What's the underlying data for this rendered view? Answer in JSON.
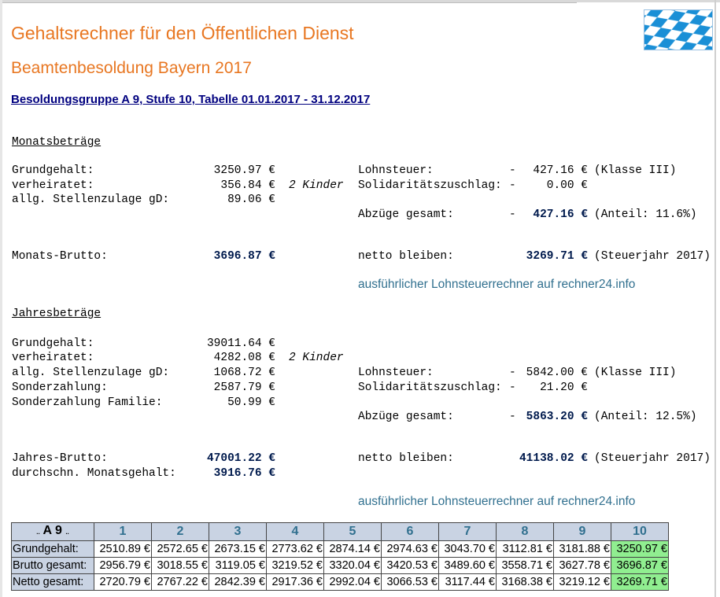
{
  "page": {
    "title": "Gehaltsrechner für den Öffentlichen Dienst",
    "subtitle": "Beamtenbesoldung Bayern 2017",
    "heading": "Besoldungsgruppe A 9, Stufe 10, Tabelle 01.01.2017 - 31.12.2017"
  },
  "flag_colors": {
    "blue": "#1a8fd6",
    "white": "#ffffff"
  },
  "monthly": {
    "section": "Monatsbeträge",
    "left": [
      {
        "label": "Grundgehalt:",
        "value": "3250.97 €",
        "note": ""
      },
      {
        "label": "verheiratet:",
        "value": "356.84 €",
        "note": "2 Kinder"
      },
      {
        "label": "allg. Stellenzulage gD:",
        "value": "89.06 €",
        "note": ""
      }
    ],
    "right": [
      {
        "label": "Lohnsteuer:",
        "sign": "-",
        "value": "427.16 €",
        "extra": "(Klasse III)"
      },
      {
        "label": "Solidaritätszuschlag:",
        "sign": "-",
        "value": "0.00 €",
        "extra": ""
      }
    ],
    "deductions": {
      "label": "Abzüge gesamt:",
      "sign": "-",
      "value": "427.16 €",
      "extra": "(Anteil: 11.6%)"
    },
    "gross": {
      "label": "Monats-Brutto:",
      "value": "3696.87 €"
    },
    "net": {
      "label": "netto bleiben:",
      "value": "3269.71 €",
      "extra": "(Steuerjahr 2017)"
    },
    "link": "ausführlicher Lohnsteuerrechner auf rechner24.info"
  },
  "yearly": {
    "section": "Jahresbeträge",
    "left": [
      {
        "label": "Grundgehalt:",
        "value": "39011.64 €",
        "note": ""
      },
      {
        "label": "verheiratet:",
        "value": "4282.08 €",
        "note": "2 Kinder"
      },
      {
        "label": "allg. Stellenzulage gD:",
        "value": "1068.72 €",
        "note": ""
      },
      {
        "label": "Sonderzahlung:",
        "value": "2587.79 €",
        "note": ""
      },
      {
        "label": "Sonderzahlung Familie:",
        "value": "50.99 €",
        "note": ""
      }
    ],
    "right": [
      {
        "label": "Lohnsteuer:",
        "sign": "-",
        "value": "5842.00 €",
        "extra": "(Klasse III)"
      },
      {
        "label": "Solidaritätszuschlag:",
        "sign": "-",
        "value": "21.20 €",
        "extra": ""
      }
    ],
    "deductions": {
      "label": "Abzüge gesamt:",
      "sign": "-",
      "value": "5863.20 €",
      "extra": "(Anteil: 12.5%)"
    },
    "gross": {
      "label": "Jahres-Brutto:",
      "value": "47001.22 €"
    },
    "avg": {
      "label": "durchschn. Monatsgehalt:",
      "value": "3916.76 €"
    },
    "net": {
      "label": "netto bleiben:",
      "value": "41138.02 €",
      "extra": "(Steuerjahr 2017)"
    },
    "link": "ausführlicher Lohnsteuerrechner auf rechner24.info"
  },
  "table": {
    "corner": {
      "pre": "..",
      "main": "A 9",
      "post": ".."
    },
    "columns": [
      "1",
      "2",
      "3",
      "4",
      "5",
      "6",
      "7",
      "8",
      "9",
      "10"
    ],
    "highlight_color": "#90ee90",
    "rows": [
      {
        "label": "Grundgehalt:",
        "values": [
          "2510.89 €",
          "2572.65 €",
          "2673.15 €",
          "2773.62 €",
          "2874.14 €",
          "2974.63 €",
          "3043.70 €",
          "3112.81 €",
          "3181.88 €",
          "3250.97 €"
        ]
      },
      {
        "label": "Brutto gesamt:",
        "values": [
          "2956.79 €",
          "3018.55 €",
          "3119.05 €",
          "3219.52 €",
          "3320.04 €",
          "3420.53 €",
          "3489.60 €",
          "3558.71 €",
          "3627.78 €",
          "3696.87 €"
        ]
      },
      {
        "label": "Netto gesamt:",
        "values": [
          "2720.79 €",
          "2767.22 €",
          "2842.39 €",
          "2917.36 €",
          "2992.04 €",
          "3066.53 €",
          "3117.44 €",
          "3168.38 €",
          "3219.12 €",
          "3269.71 €"
        ]
      }
    ]
  }
}
